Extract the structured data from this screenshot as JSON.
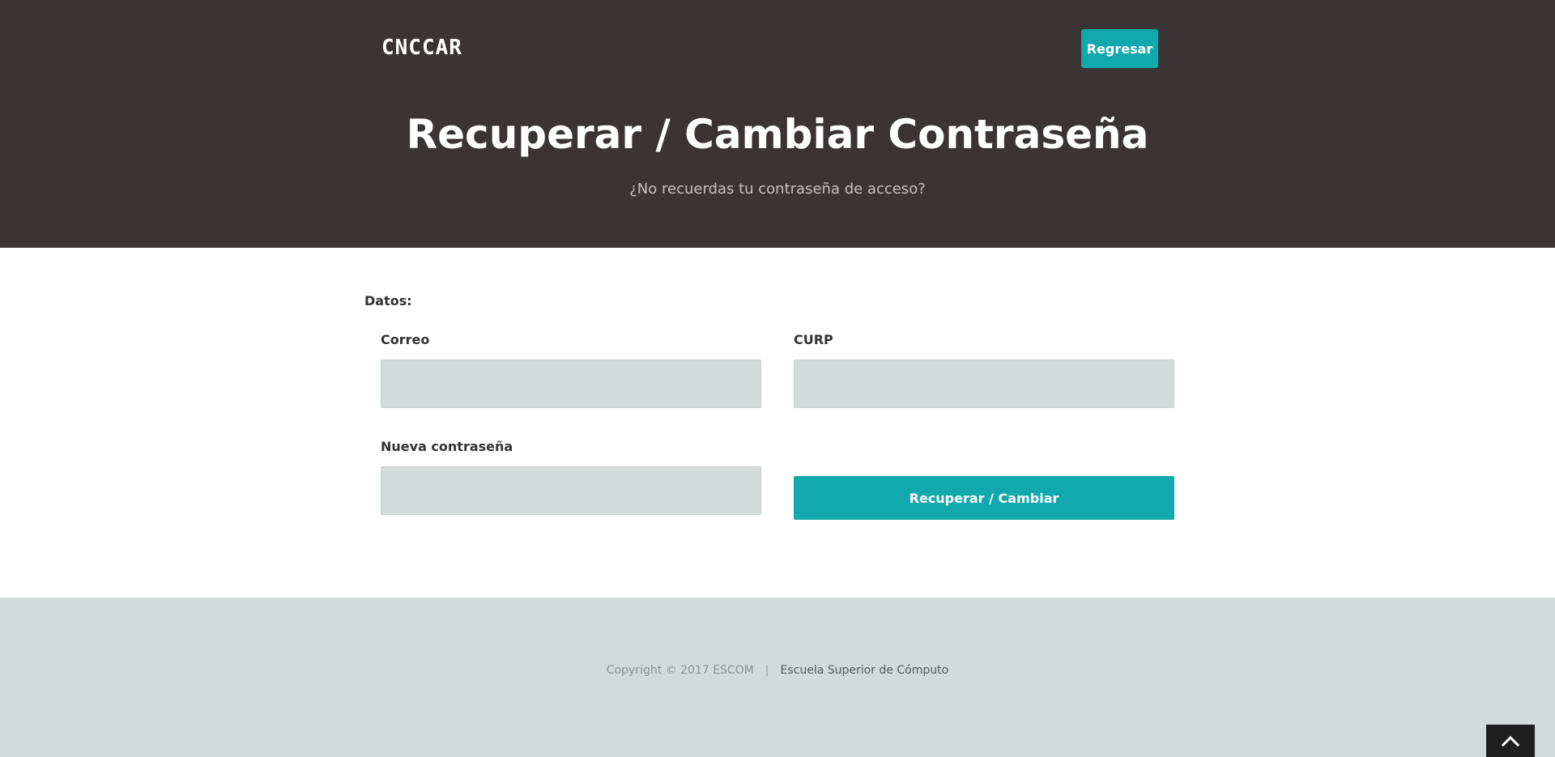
{
  "header": {
    "logo_text": "CNCCAR",
    "back_button_label": "Regresar",
    "title": "Recuperar / Cambiar Contraseña",
    "subtitle": "¿No recuerdas tu contraseña de acceso?"
  },
  "form": {
    "section_label": "Datos:",
    "fields": [
      {
        "label": "Correo",
        "value": "",
        "placeholder": ""
      },
      {
        "label": "CURP",
        "value": "",
        "placeholder": ""
      },
      {
        "label": "Nueva contraseña",
        "value": "",
        "placeholder": ""
      }
    ],
    "submit_label": "Recuperar / Cambiar"
  },
  "footer": {
    "copyright": "Copyright © 2017 ESCOM",
    "separator": "|",
    "link_text": "Escuela Superior de Cómputo"
  },
  "icons": {
    "scroll_top": "chevron-up-icon"
  },
  "colors": {
    "header_bg": "#3b3434",
    "accent": "#12a9ae",
    "input_bg": "#d4dada",
    "footer_bg": "#d4dada"
  }
}
